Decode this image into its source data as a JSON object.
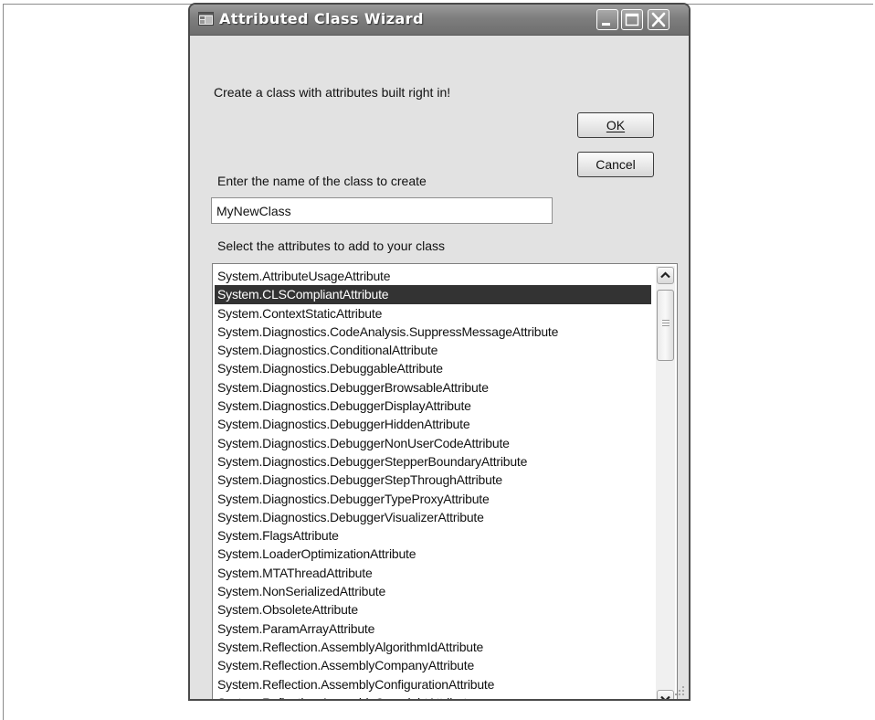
{
  "window": {
    "title": "Attributed Class Wizard",
    "minimize_icon": "minimize-icon",
    "maximize_icon": "maximize-icon",
    "close_icon": "close-icon"
  },
  "intro_text": "Create a class with attributes built right in!",
  "buttons": {
    "ok_label": "OK",
    "cancel_label": "Cancel"
  },
  "class_name": {
    "label": "Enter the name of the class to create",
    "value": "MyNewClass"
  },
  "attributes": {
    "label": "Select the attributes to add to your class",
    "selected_index": 1,
    "items": [
      "System.AttributeUsageAttribute",
      "System.CLSCompliantAttribute",
      "System.ContextStaticAttribute",
      "System.Diagnostics.CodeAnalysis.SuppressMessageAttribute",
      "System.Diagnostics.ConditionalAttribute",
      "System.Diagnostics.DebuggableAttribute",
      "System.Diagnostics.DebuggerBrowsableAttribute",
      "System.Diagnostics.DebuggerDisplayAttribute",
      "System.Diagnostics.DebuggerHiddenAttribute",
      "System.Diagnostics.DebuggerNonUserCodeAttribute",
      "System.Diagnostics.DebuggerStepperBoundaryAttribute",
      "System.Diagnostics.DebuggerStepThroughAttribute",
      "System.Diagnostics.DebuggerTypeProxyAttribute",
      "System.Diagnostics.DebuggerVisualizerAttribute",
      "System.FlagsAttribute",
      "System.LoaderOptimizationAttribute",
      "System.MTAThreadAttribute",
      "System.NonSerializedAttribute",
      "System.ObsoleteAttribute",
      "System.ParamArrayAttribute",
      "System.Reflection.AssemblyAlgorithmIdAttribute",
      "System.Reflection.AssemblyCompanyAttribute",
      "System.Reflection.AssemblyConfigurationAttribute",
      "System.Reflection.AssemblyCopyrightAttribute"
    ]
  },
  "colors": {
    "selection_background": "#333333",
    "selection_text": "#ffffff",
    "titlebar": "#7e7e7e"
  }
}
